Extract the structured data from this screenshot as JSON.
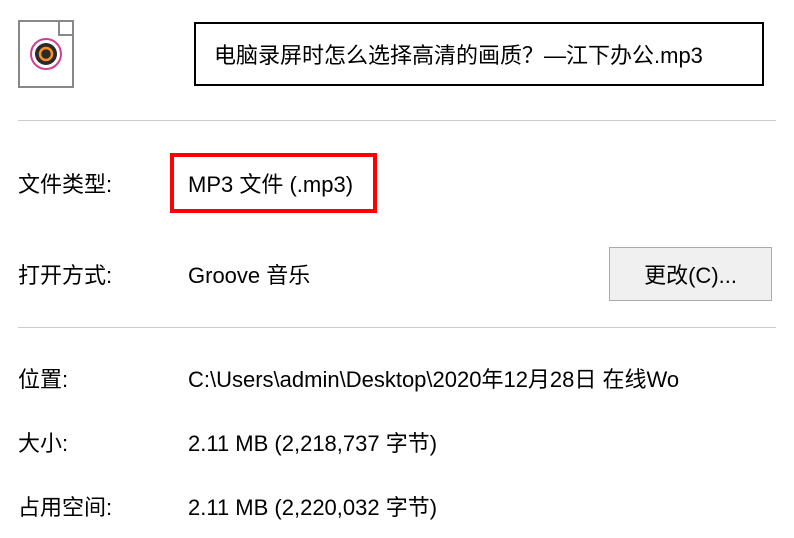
{
  "filename": "电脑录屏时怎么选择高清的画质？—江下办公.mp3",
  "labels": {
    "file_type": "文件类型:",
    "open_with": "打开方式:",
    "location": "位置:",
    "size": "大小:",
    "size_on_disk": "占用空间:"
  },
  "values": {
    "file_type": "MP3 文件 (.mp3)",
    "open_with": "Groove 音乐",
    "location": "C:\\Users\\admin\\Desktop\\2020年12月28日 在线Wo",
    "size": "2.11 MB (2,218,737 字节)",
    "size_on_disk": "2.11 MB (2,220,032 字节)"
  },
  "buttons": {
    "change": "更改(C)..."
  }
}
